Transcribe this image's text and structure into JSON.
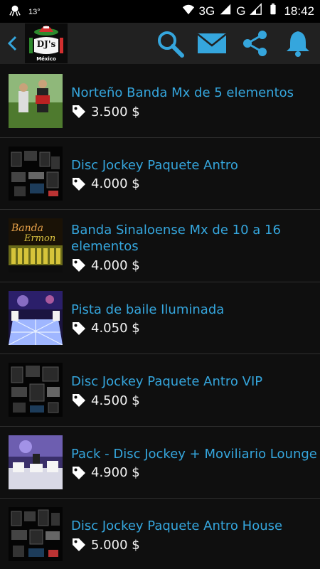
{
  "status_bar": {
    "notification_temp": "13°",
    "network": "3G",
    "network2": "G",
    "time": "18:42"
  },
  "app_bar": {
    "logo_text_line1": "DJ's",
    "logo_text_line2": "México"
  },
  "colors": {
    "accent": "#35a6dd",
    "background": "#0f0f0f",
    "app_bar": "#212121"
  },
  "products": [
    {
      "title": "Norteño Banda Mx  de 5 elementos",
      "price": "3.500 $",
      "thumb": "band-photo"
    },
    {
      "title": "Disc Jockey  Paquete Antro",
      "price": "4.000 $",
      "thumb": "dj-equipment"
    },
    {
      "title": "Banda Sinaloense Mx  de 10 a 16 elementos",
      "price": "4.000 $",
      "thumb": "banda-ermon",
      "thumb_text1": "Banda",
      "thumb_text2": "Ermon"
    },
    {
      "title": "Pista de baile Iluminada",
      "price": "4.050 $",
      "thumb": "dance-floor"
    },
    {
      "title": "Disc Jockey  Paquete Antro VIP",
      "price": "4.500 $",
      "thumb": "dj-equipment"
    },
    {
      "title": "Pack - Disc Jockey + Moviliario Lounge",
      "price": "4.900 $",
      "thumb": "lounge"
    },
    {
      "title": "Disc Jockey  Paquete Antro House",
      "price": "5.000 $",
      "thumb": "dj-equipment"
    }
  ]
}
